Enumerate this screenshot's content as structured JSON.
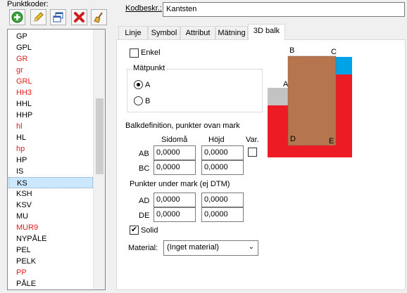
{
  "left": {
    "title": "Punktkoder:",
    "items": [
      {
        "label": "GP",
        "color": "#000000"
      },
      {
        "label": "GPL",
        "color": "#000000"
      },
      {
        "label": "GR",
        "color": "#e51c1c"
      },
      {
        "label": "gr",
        "color": "#e51c1c"
      },
      {
        "label": "GRL",
        "color": "#e51c1c"
      },
      {
        "label": "HH3",
        "color": "#e51c1c"
      },
      {
        "label": "HHL",
        "color": "#000000"
      },
      {
        "label": "HHP",
        "color": "#000000"
      },
      {
        "label": "hl",
        "color": "#e51c1c"
      },
      {
        "label": "HL",
        "color": "#000000"
      },
      {
        "label": "hp",
        "color": "#e51c1c"
      },
      {
        "label": "HP",
        "color": "#000000"
      },
      {
        "label": "IS",
        "color": "#000000"
      },
      {
        "label": "KS",
        "color": "#000000"
      },
      {
        "label": "KSH",
        "color": "#000000"
      },
      {
        "label": "KSV",
        "color": "#000000"
      },
      {
        "label": "MU",
        "color": "#000000"
      },
      {
        "label": "MUR9",
        "color": "#e51c1c"
      },
      {
        "label": "NYPÅLE",
        "color": "#000000"
      },
      {
        "label": "PEL",
        "color": "#000000"
      },
      {
        "label": "PELK",
        "color": "#000000"
      },
      {
        "label": "PP",
        "color": "#e51c1c"
      },
      {
        "label": "PÅLE",
        "color": "#000000"
      }
    ],
    "selected_index": 13
  },
  "header": {
    "kod_label": "Kodbeskr.:",
    "kod_value": "Kantsten"
  },
  "tabs": [
    {
      "label": "Linje"
    },
    {
      "label": "Symbol"
    },
    {
      "label": "Attribut"
    },
    {
      "label": "Mätning"
    },
    {
      "label": "3D balk"
    }
  ],
  "active_tab": "3D balk",
  "panel": {
    "enkel_label": "Enkel",
    "enkel_checked": false,
    "matpunkt_title": "Mätpunkt",
    "radio_a": "A",
    "radio_b": "B",
    "radio_selected": "A",
    "balk_title": "Balkdefinition, punkter ovan mark",
    "col_sidoma": "Sidomå",
    "col_hojd": "Höjd",
    "col_var": "Var.",
    "row_ab": "AB",
    "row_bc": "BC",
    "ab_sidoma": "0,0000",
    "ab_hojd": "0,0000",
    "bc_sidoma": "0,0000",
    "bc_hojd": "0,0000",
    "var_checked": false,
    "under_title": "Punkter under mark (ej DTM)",
    "row_ad": "AD",
    "row_de": "DE",
    "ad_sidoma": "0,0000",
    "ad_hojd": "0,0000",
    "de_sidoma": "0,0000",
    "de_hojd": "0,0000",
    "solid_label": "Solid",
    "solid_checked": true,
    "material_label": "Material:",
    "material_value": "(Inget material)"
  },
  "preview": {
    "letters": [
      "A",
      "B",
      "C",
      "D",
      "E"
    ],
    "colors": {
      "ground": "#ed1c24",
      "beam": "#b5764f",
      "grey": "#c3c3c3",
      "blue": "#00a2e8"
    }
  }
}
